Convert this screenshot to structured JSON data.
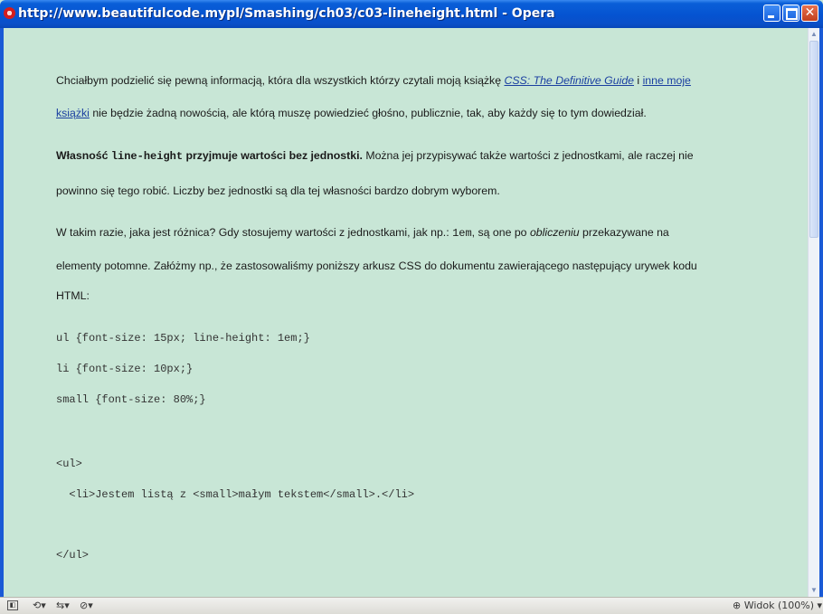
{
  "window": {
    "title": "http://www.beautifulcode.mypl/Smashing/ch03/c03-lineheight.html - Opera",
    "close_glyph": "✕"
  },
  "article": {
    "p1": {
      "l1_a": "Chciałbym podzielić się pewną informacją, która dla wszystkich którzy czytali moją książkę ",
      "l1_link": "CSS: The Definitive Guide",
      "l1_b": " i ",
      "l1_link2": "inne moje",
      "l2_link": "książki",
      "l2_b": " nie będzie żadną nowością, ale którą muszę powiedzieć głośno, publicznie, tak, aby każdy się to tym dowiedział."
    },
    "p2": {
      "l1_bold1": "Własność ",
      "l1_code": "line-height",
      "l1_bold2": " przyjmuje wartości bez jednostki.",
      "l1_rest": " Można jej przypisywać także wartości z jednostkami, ale raczej nie",
      "l2": "powinno się tego robić. Liczby bez jednostki są dla tej własności bardzo dobrym wyborem."
    },
    "p3": {
      "l1_a": "W takim razie, jaka jest różnica? Gdy stosujemy wartości z jednostkami, jak np.: ",
      "l1_code": "1em",
      "l1_b": ", są one po ",
      "l1_em": "obliczeniu",
      "l1_c": " przekazywane na",
      "l2": "elementy potomne. Załóżmy np., że zastosowaliśmy poniższy arkusz CSS do dokumentu zawierającego następujący urywek kodu",
      "l3": "HTML:"
    },
    "code": {
      "c1": "ul {font-size: 15px; line-height: 1em;}",
      "c2": "li {font-size: 10px;}",
      "c3": "small {font-size: 80%;}",
      "c4": "<ul>",
      "c5": "  <li>Jestem listą z <small>małym tekstem</small>.</li>",
      "c6": "</ul>"
    }
  },
  "scrollbar": {
    "up_glyph": "▲",
    "down_glyph": "▼",
    "position": 0.0
  },
  "statusbar": {
    "panels_glyph": "◧",
    "sync_label": "⟲▾",
    "unite_label": "⇆▾",
    "turbo_label": "⊘▾",
    "zoom_label": "Widok (100%)",
    "zoom_icon": "⊕",
    "zoom_arrow": "▾"
  }
}
